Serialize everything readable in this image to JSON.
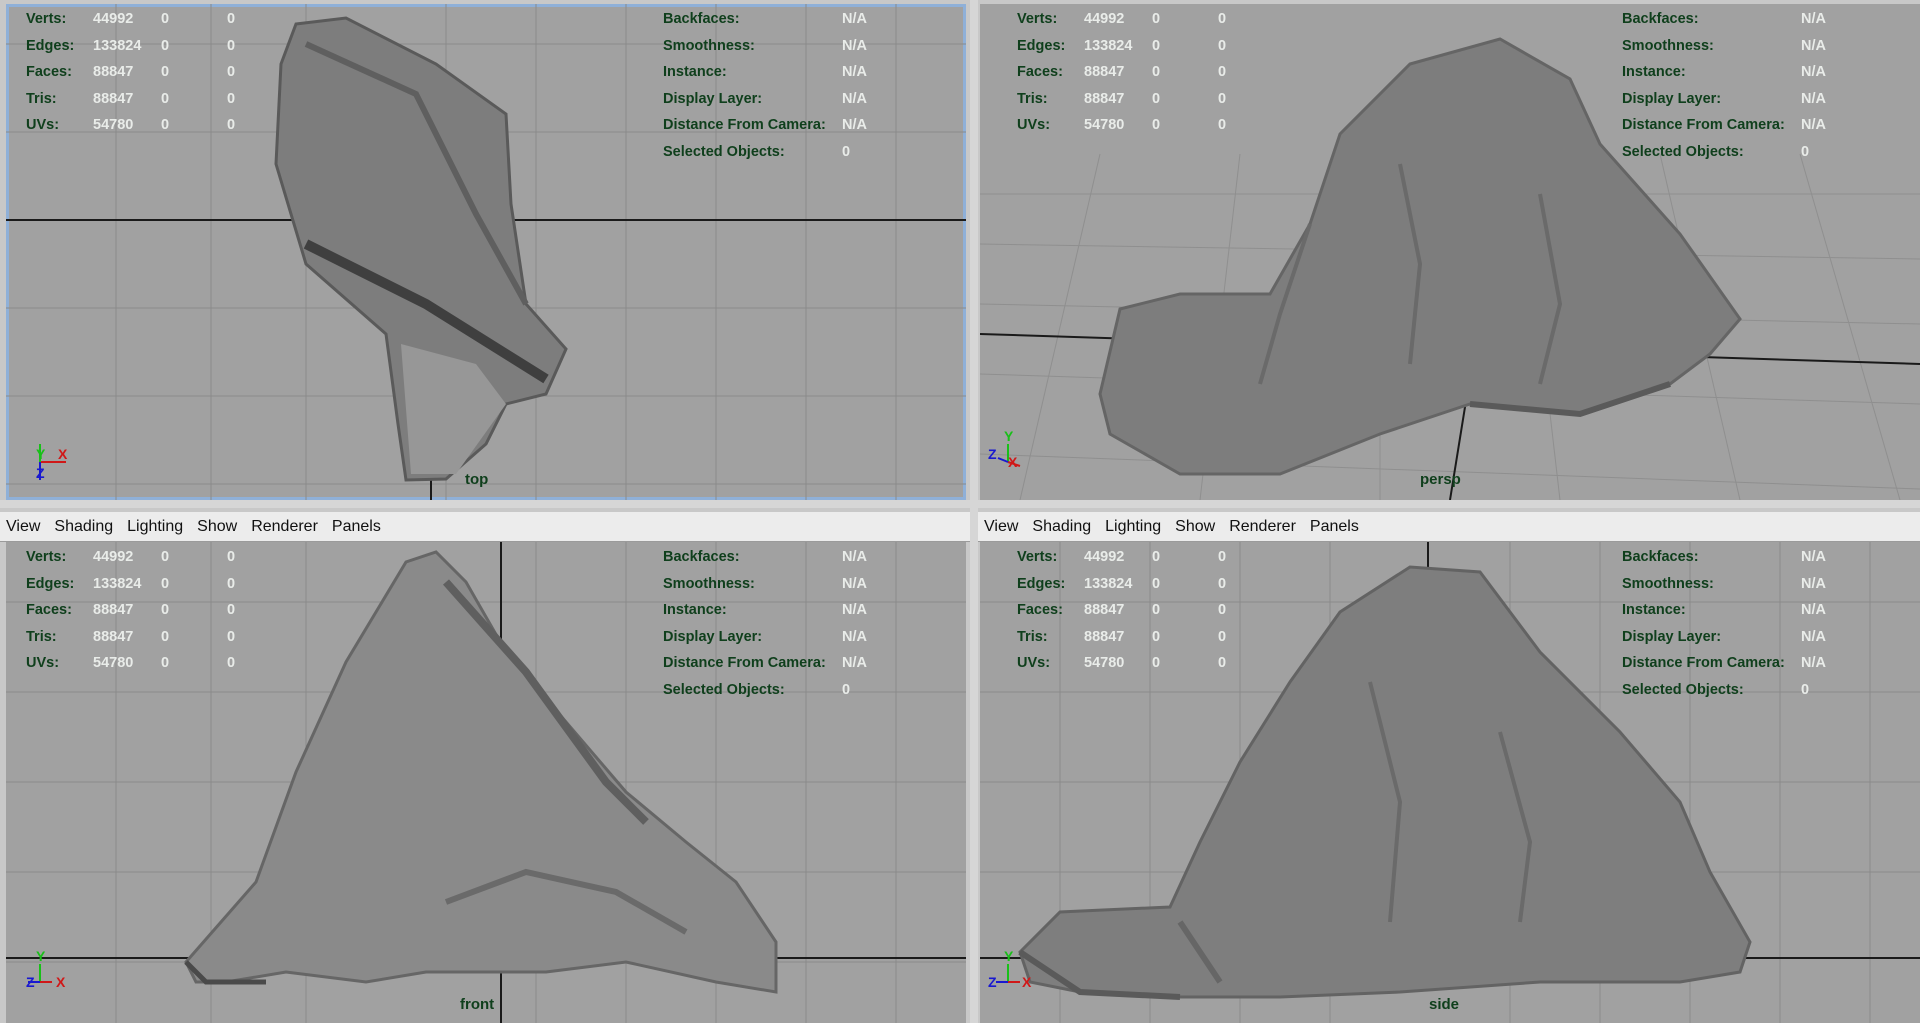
{
  "menu": [
    "View",
    "Shading",
    "Lighting",
    "Show",
    "Renderer",
    "Panels"
  ],
  "stats": {
    "labels": [
      "Verts:",
      "Edges:",
      "Faces:",
      "Tris:",
      "UVs:"
    ],
    "values": [
      [
        "44992",
        "0",
        "0"
      ],
      [
        "133824",
        "0",
        "0"
      ],
      [
        "88847",
        "0",
        "0"
      ],
      [
        "88847",
        "0",
        "0"
      ],
      [
        "54780",
        "0",
        "0"
      ]
    ]
  },
  "info": {
    "labels": [
      "Backfaces:",
      "Smoothness:",
      "Instance:",
      "Display Layer:",
      "Distance From Camera:",
      "Selected Objects:"
    ],
    "values": [
      "N/A",
      "N/A",
      "N/A",
      "N/A",
      "N/A",
      "0"
    ]
  },
  "viewports": {
    "top": {
      "camera": "top"
    },
    "persp": {
      "camera": "persp"
    },
    "front": {
      "camera": "front"
    },
    "side": {
      "camera": "side"
    }
  },
  "axes": {
    "top": [
      "Y",
      "X",
      "Z"
    ],
    "persp": [
      "Z",
      "Y",
      "X"
    ],
    "front": [
      "Y",
      "Z",
      "X"
    ],
    "side": [
      "Y",
      "Z",
      "X"
    ]
  },
  "colors": {
    "viewport_bg": "#a1a1a1",
    "hud_label": "#0f3f1c",
    "hud_value": "#e9ece9",
    "grid": "#8a8a8a",
    "axis_line": "#1a1a1a",
    "mesh": "#7d7d7d",
    "active_border": "#8fb0d8"
  }
}
